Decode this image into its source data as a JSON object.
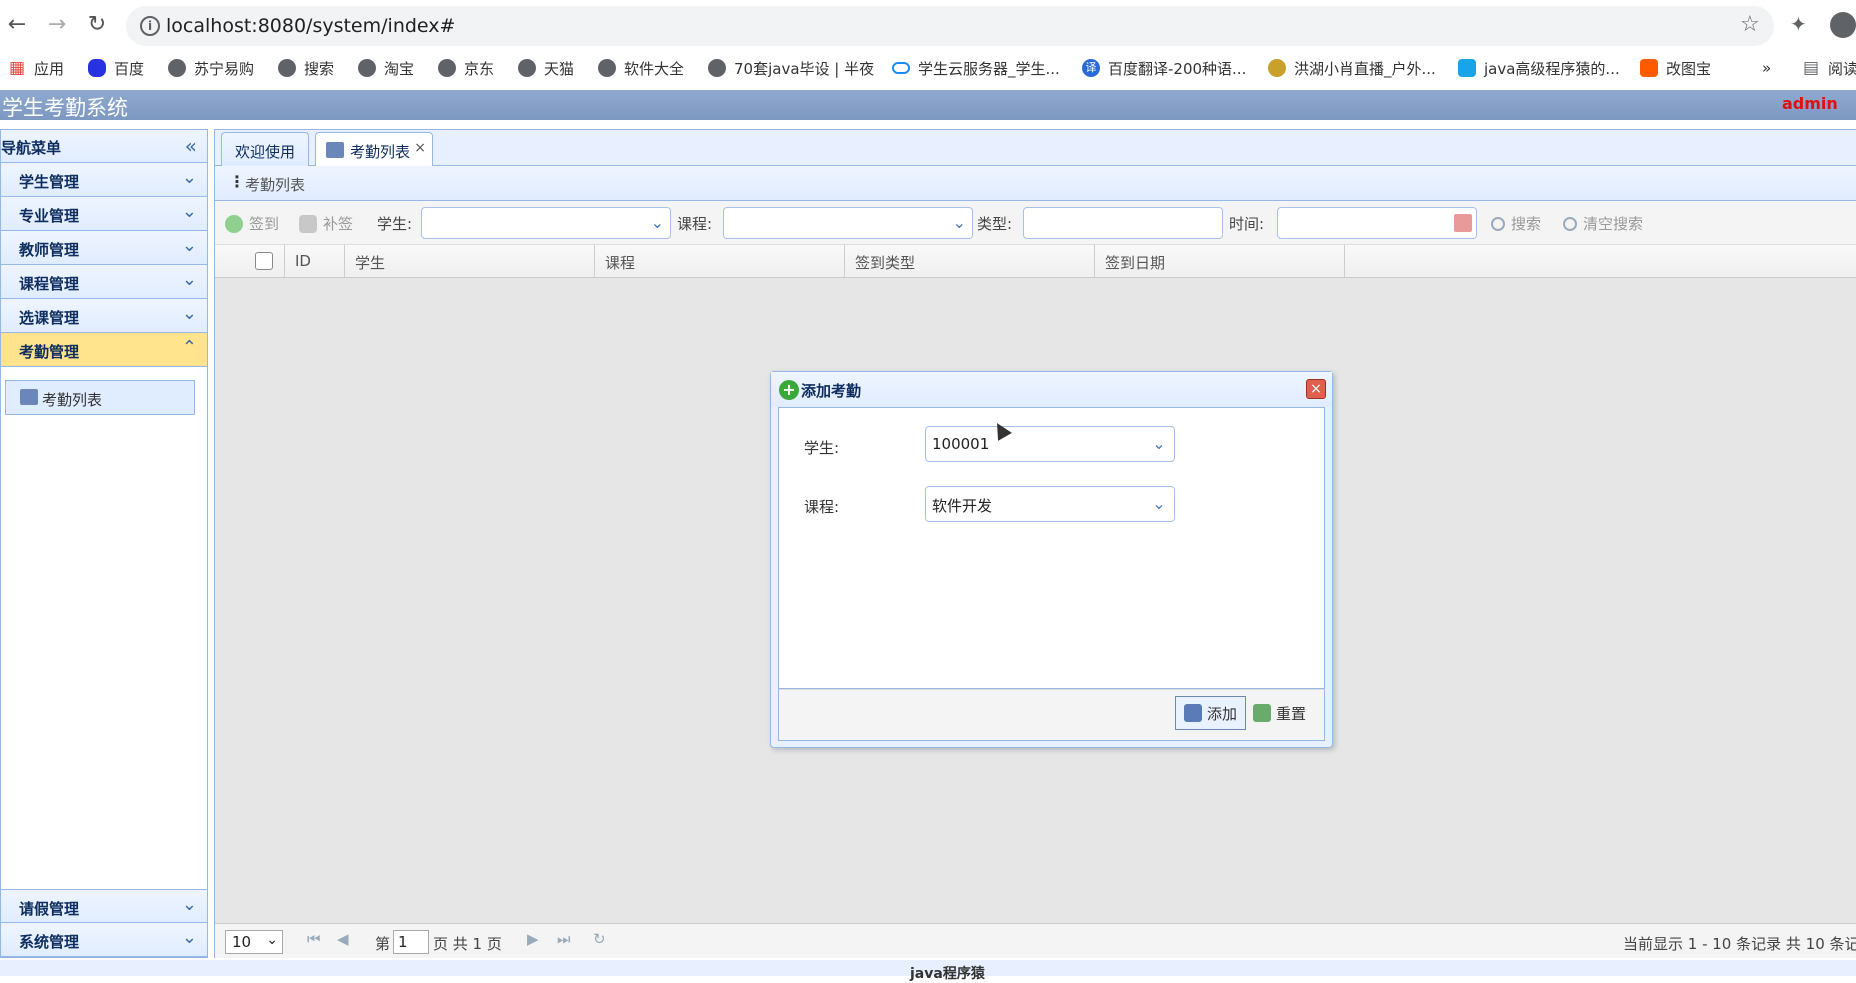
{
  "browser": {
    "url": "localhost:8080/system/index#",
    "bookmarks": [
      "应用",
      "百度",
      "苏宁易购",
      "搜索",
      "淘宝",
      "京东",
      "天猫",
      "软件大全",
      "70套java毕设 | 半夜",
      "学生云服务器_学生...",
      "百度翻译-200种语...",
      "洪湖小肖直播_户外...",
      "java高级程序猿的...",
      "改图宝"
    ],
    "bookmarks_more": "»",
    "reading_list": "阅读"
  },
  "app": {
    "title": "学生考勤系统",
    "user": "admin",
    "footer": "java程序猿"
  },
  "sidebar": {
    "title": "导航菜单",
    "items": [
      {
        "label": "学生管理"
      },
      {
        "label": "专业管理"
      },
      {
        "label": "教师管理"
      },
      {
        "label": "课程管理"
      },
      {
        "label": "选课管理"
      },
      {
        "label": "考勤管理"
      }
    ],
    "sub_item": "考勤列表",
    "bottom_items": [
      {
        "label": "请假管理"
      },
      {
        "label": "系统管理"
      }
    ]
  },
  "tabs": [
    {
      "label": "欢迎使用"
    },
    {
      "label": "考勤列表"
    }
  ],
  "panel": {
    "title": "考勤列表"
  },
  "toolbar": {
    "sign_label": "签到",
    "resign_label": "补签",
    "student_label": "学生:",
    "course_label": "课程:",
    "type_label": "类型:",
    "time_label": "时间:",
    "search_label": "搜索",
    "clear_label": "清空搜索"
  },
  "grid": {
    "columns": [
      "ID",
      "学生",
      "课程",
      "签到类型",
      "签到日期"
    ]
  },
  "pager": {
    "page_size": "10",
    "page_prefix": "第",
    "page_num": "1",
    "page_suffix": "页 共 1 页",
    "info": "当前显示 1 - 10 条记录 共 10 条记"
  },
  "dialog": {
    "title": "添加考勤",
    "student_label": "学生:",
    "student_value": "100001",
    "course_label": "课程:",
    "course_value": "软件开发",
    "add_label": "添加",
    "reset_label": "重置"
  }
}
